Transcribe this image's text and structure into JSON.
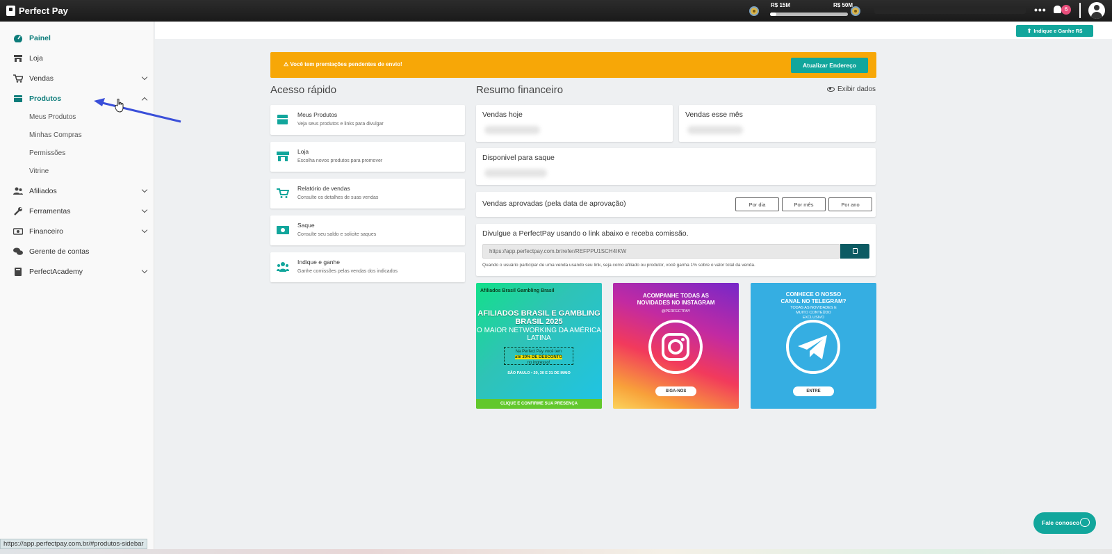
{
  "topbar": {
    "brand": "Perfect Pay",
    "level_current": "R$ 15M",
    "level_next": "R$ 50M",
    "level_progress": 0.08,
    "notifications_count": "6"
  },
  "sidebar": {
    "items": [
      {
        "label": "Painel"
      },
      {
        "label": "Loja"
      },
      {
        "label": "Vendas"
      },
      {
        "label": "Produtos"
      },
      {
        "label": "Afiliados"
      },
      {
        "label": "Ferramentas"
      },
      {
        "label": "Financeiro"
      },
      {
        "label": "Gerente de contas"
      },
      {
        "label": "PerfectAcademy"
      }
    ],
    "produtos_sub": [
      "Meus Produtos",
      "Minhas Compras",
      "Permissões",
      "Vitrine"
    ]
  },
  "header": {
    "indique_label": "Indique e Ganhe R$"
  },
  "alert": {
    "text": "⚠ Você tem premiações pendentes de envio!",
    "button": "Atualizar Endereço"
  },
  "quick": {
    "title": "Acesso rápido",
    "cards": [
      {
        "title": "Meus Produtos",
        "subtitle": "Veja seus produtos e links para divulgar"
      },
      {
        "title": "Loja",
        "subtitle": "Escolha novos produtos para promover"
      },
      {
        "title": "Relatório de vendas",
        "subtitle": "Consulte os detalhes de suas vendas"
      },
      {
        "title": "Saque",
        "subtitle": "Consulte seu saldo e solicite saques"
      },
      {
        "title": "Indique e ganhe",
        "subtitle": "Ganhe comissões pelas vendas dos indicados"
      }
    ]
  },
  "finance": {
    "title": "Resumo financeiro",
    "show_data": "Exibir dados",
    "vendas_hoje": "Vendas hoje",
    "vendas_mes": "Vendas esse mês",
    "disponivel": "Disponivel para saque",
    "aprovadas": "Vendas aprovadas (pela data de aprovação)",
    "periods": [
      "Por dia",
      "Por mês",
      "Por ano"
    ],
    "divulgue": "Divulgue a PerfectPay usando o link abaixo e receba comissão.",
    "link": "https://app.perfectpay.com.br/refer/REFPPU1SCH4IKW",
    "note": "Quando o usuário participar de uma venda usando seu link, seja como afiliado ou produtor, você ganha 1% sobre o valor total da venda."
  },
  "banners": {
    "event": {
      "logos": "Afiliados Brasil  Gambling Brasil",
      "headline": "AFILIADOS BRASIL E GAMBLING BRASIL 2025",
      "sub": "O MAIOR NETWORKING DA AMÉRICA LATINA",
      "box_pre": "Na Perfect Pay você tem",
      "box_hl": "até 30% DE DESCONTO",
      "box_post": "no ingresso!",
      "date": "SÃO PAULO • 20, 30 E 31 DE MAIO",
      "footer": "CLIQUE E CONFIRME SUA PRESENÇA"
    },
    "instagram": {
      "title": "ACOMPANHE TODAS AS NOVIDADES NO INSTAGRAM",
      "handle": "@PERFECTPAY",
      "button": "SIGA-NOS"
    },
    "telegram": {
      "title": "CONHECE O NOSSO CANAL NO TELEGRAM?",
      "sub": "TODAS AS NOVIDADES E MUITO CONTEÚDO EXCLUSIVO",
      "button": "ENTRE"
    }
  },
  "chat": {
    "label": "Fale conosco"
  },
  "status_url": "https://app.perfectpay.com.br/#produtos-sidebar",
  "colors": {
    "accent": "#12a69c",
    "warning": "#f7a707",
    "active_nav": "#0d7c7a",
    "arrow": "#3a4fd9"
  }
}
